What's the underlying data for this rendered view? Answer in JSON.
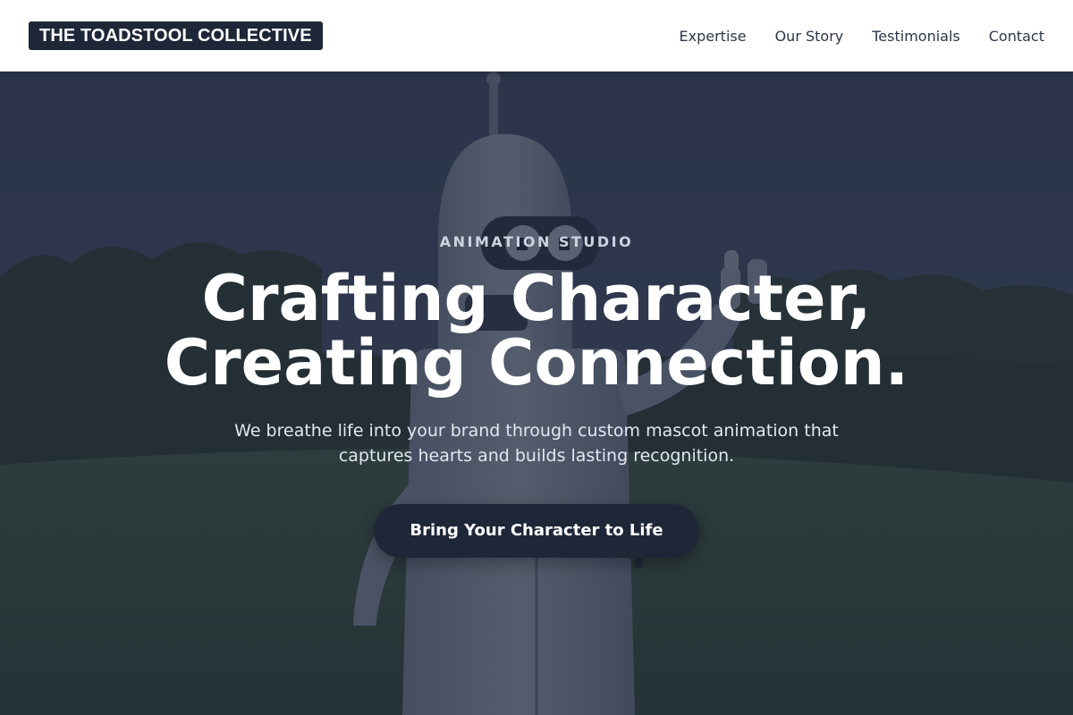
{
  "header": {
    "logo_text": "THE TOADSTOOL COLLECTIVE",
    "nav": [
      {
        "label": "Expertise"
      },
      {
        "label": "Our Story"
      },
      {
        "label": "Testimonials"
      },
      {
        "label": "Contact"
      }
    ]
  },
  "hero": {
    "eyebrow": "ANIMATION STUDIO",
    "headline_line1": "Crafting Character,",
    "headline_line2": "Creating Connection.",
    "subtext": "We breathe life into your brand through custom mascot animation that captures hearts and builds lasting recognition.",
    "cta_label": "Bring Your Character to Life",
    "background_image": "robot mascot standing in grassy field with trees"
  },
  "colors": {
    "brand_navy": "#1e2738",
    "header_bg": "#ffffff",
    "nav_text": "#2d3748",
    "eyebrow_text": "#cbd5e0"
  }
}
